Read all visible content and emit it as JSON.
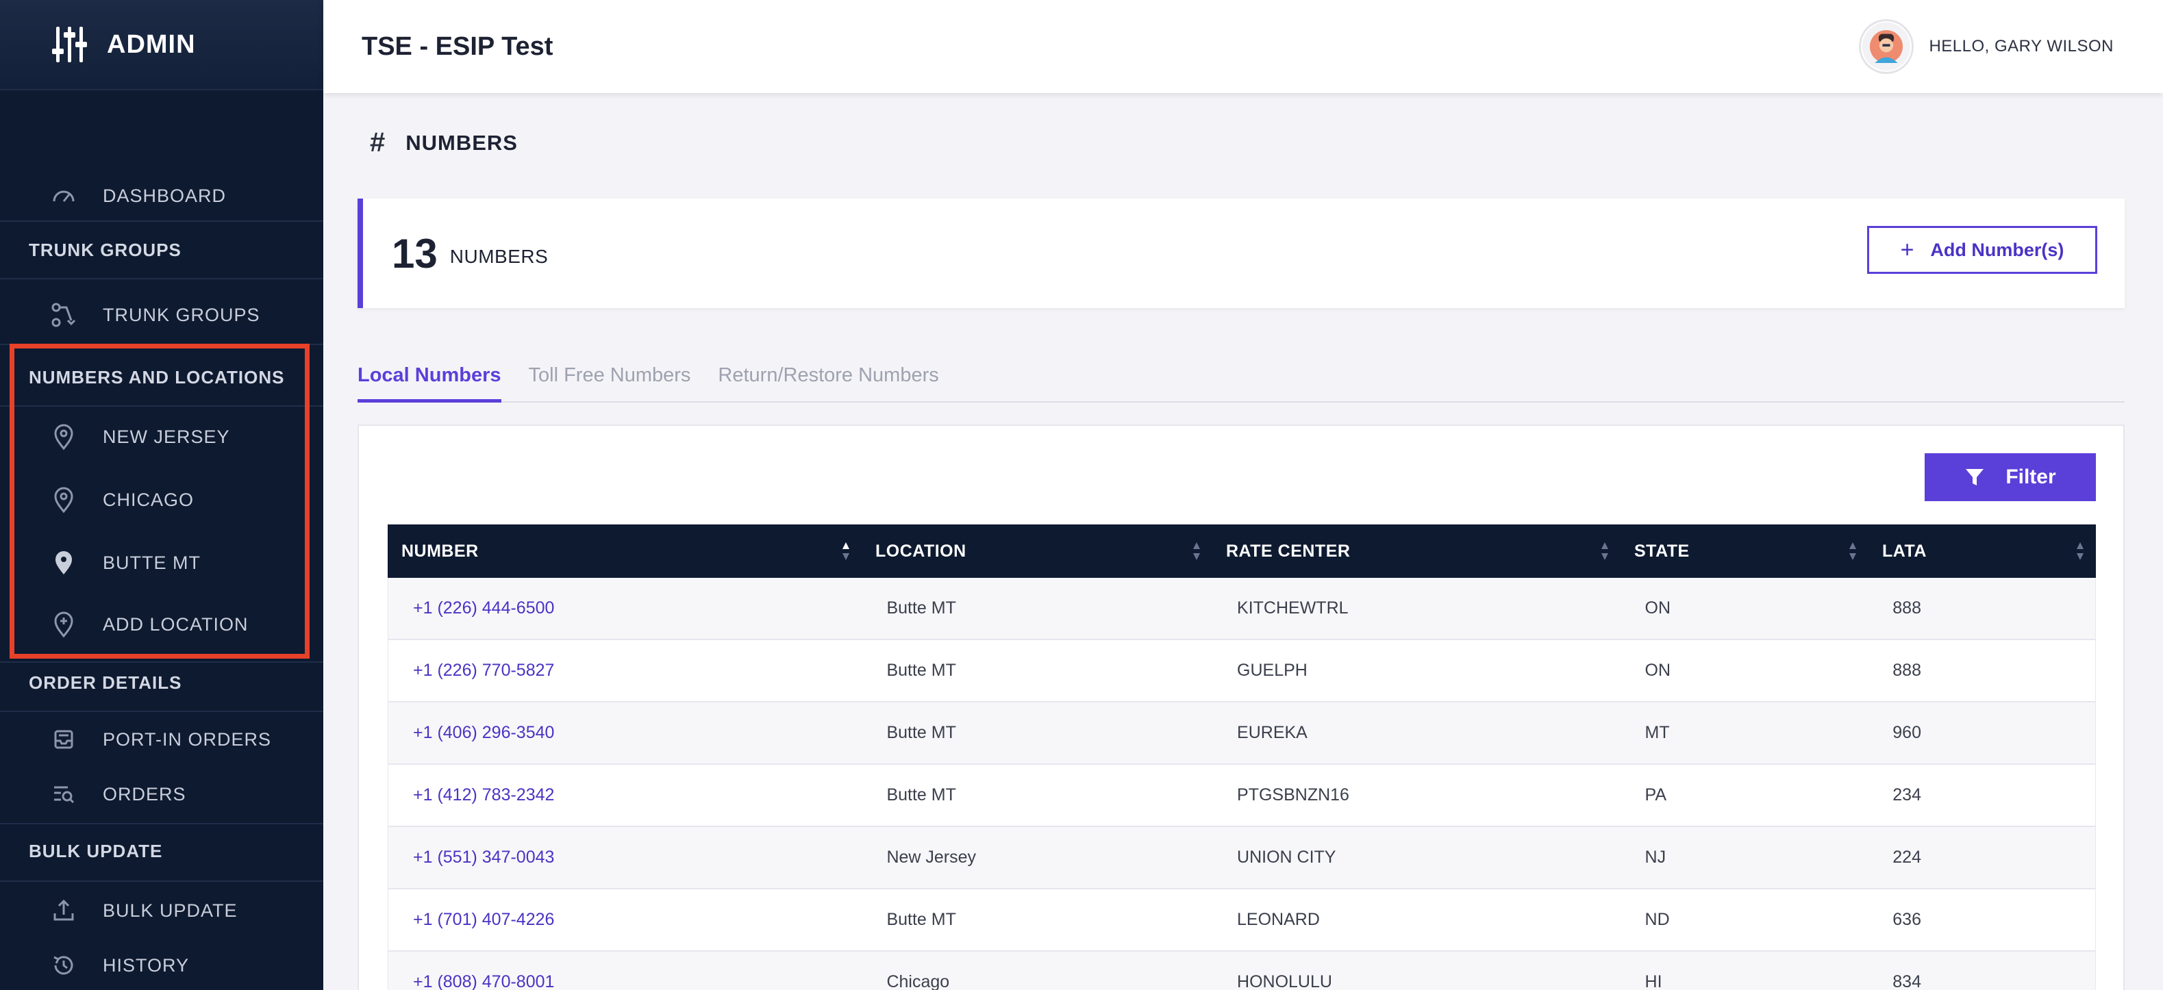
{
  "app": {
    "brand": "ADMIN",
    "org_title": "TSE - ESIP Test",
    "greeting": "HELLO, GARY WILSON"
  },
  "sidebar": {
    "dashboard": "DASHBOARD",
    "sections": {
      "trunk_groups": "TRUNK GROUPS",
      "numbers_locations": "NUMBERS AND LOCATIONS",
      "order_details": "ORDER DETAILS",
      "bulk_update": "BULK UPDATE"
    },
    "items": {
      "trunk_groups": "TRUNK GROUPS",
      "new_jersey": "NEW JERSEY",
      "chicago": "CHICAGO",
      "butte_mt": "BUTTE MT",
      "add_location": "ADD LOCATION",
      "port_in_orders": "PORT-IN ORDERS",
      "orders": "ORDERS",
      "bulk_update": "BULK UPDATE",
      "history": "HISTORY"
    },
    "icons": {
      "dashboard": "gauge-icon",
      "trunk_groups": "flow-icon",
      "location": "map-pin-icon",
      "add_location": "add-pin-icon",
      "port_in": "inbox-icon",
      "orders": "list-search-icon",
      "bulk_update": "upload-icon",
      "history": "history-icon"
    }
  },
  "page": {
    "hash": "#",
    "title": "NUMBERS",
    "count": "13",
    "count_label": "NUMBERS",
    "add_button": "Add Number(s)",
    "add_plus": "+"
  },
  "tabs": [
    "Local Numbers",
    "Toll Free Numbers",
    "Return/Restore Numbers"
  ],
  "filter_label": "Filter",
  "table": {
    "columns": [
      "NUMBER",
      "LOCATION",
      "RATE CENTER",
      "STATE",
      "LATA"
    ],
    "rows": [
      [
        "+1 (226) 444-6500",
        "Butte MT",
        "KITCHEWTRL",
        "ON",
        "888"
      ],
      [
        "+1 (226) 770-5827",
        "Butte MT",
        "GUELPH",
        "ON",
        "888"
      ],
      [
        "+1 (406) 296-3540",
        "Butte MT",
        "EUREKA",
        "MT",
        "960"
      ],
      [
        "+1 (412) 783-2342",
        "Butte MT",
        "PTGSBNZN16",
        "PA",
        "234"
      ],
      [
        "+1 (551) 347-0043",
        "New Jersey",
        "UNION CITY",
        "NJ",
        "224"
      ],
      [
        "+1 (701) 407-4226",
        "Butte MT",
        "LEONARD",
        "ND",
        "636"
      ],
      [
        "+1 (808) 470-8001",
        "Chicago",
        "HONOLULU",
        "HI",
        "834"
      ]
    ]
  },
  "colors": {
    "sidebar_bg": "#0e1a30",
    "accent": "#5b3fd9",
    "highlight": "#e8412a"
  }
}
